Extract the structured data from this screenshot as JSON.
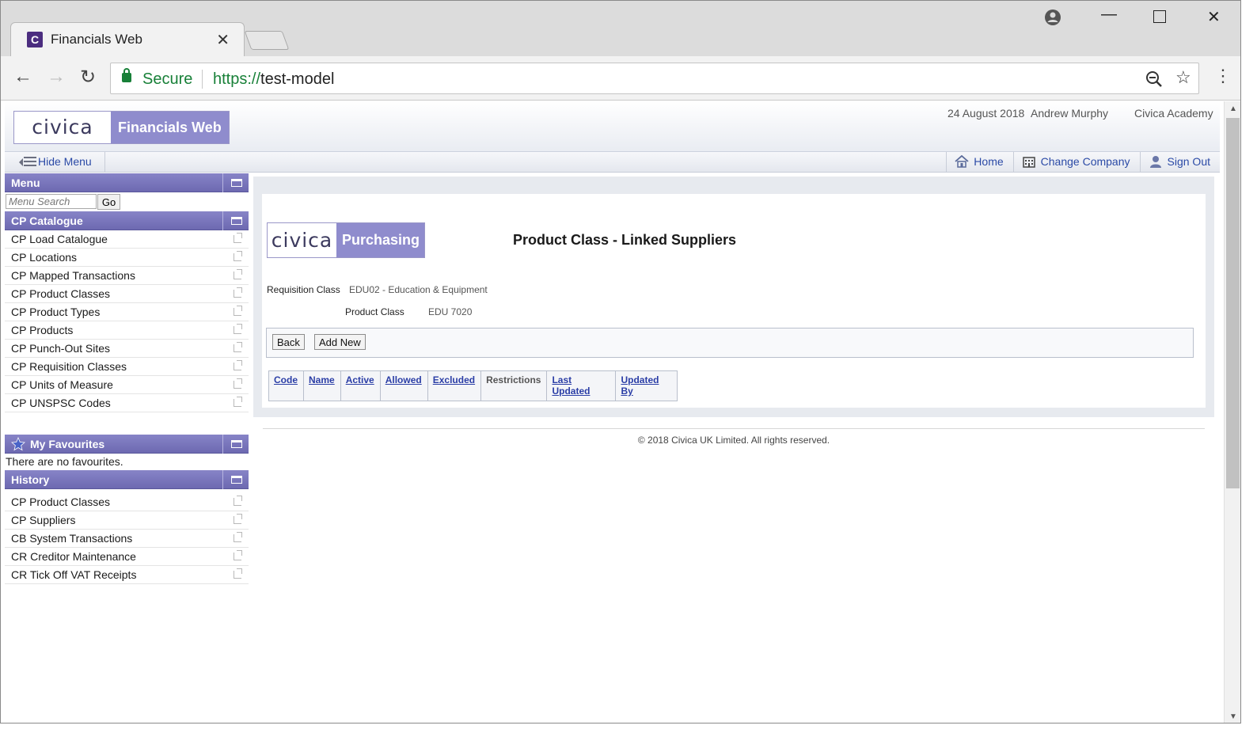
{
  "browser": {
    "tab_title": "Financials Web",
    "tab_favicon_letter": "C",
    "security_label": "Secure",
    "url_scheme": "https://",
    "url_host": "test-model"
  },
  "header": {
    "logo_brand": "civica",
    "logo_product": "Financials Web",
    "date": "24 August 2018",
    "user": "Andrew Murphy",
    "company": "Civica Academy"
  },
  "subbar": {
    "hide_menu": "Hide Menu",
    "home": "Home",
    "change_company": "Change Company",
    "sign_out": "Sign Out"
  },
  "sidebar": {
    "menu_title": "Menu",
    "search_placeholder": "Menu Search",
    "go_label": "Go",
    "catalogue_title": "CP Catalogue",
    "catalogue_items": [
      {
        "label": "CP Load Catalogue"
      },
      {
        "label": "CP Locations"
      },
      {
        "label": "CP Mapped Transactions"
      },
      {
        "label": "CP Product Classes"
      },
      {
        "label": "CP Product Types"
      },
      {
        "label": "CP Products"
      },
      {
        "label": "CP Punch-Out Sites"
      },
      {
        "label": "CP Requisition Classes"
      },
      {
        "label": "CP Units of Measure"
      },
      {
        "label": "CP UNSPSC Codes"
      }
    ],
    "favourites_title": "My Favourites",
    "favourites_empty": "There are no favourites.",
    "history_title": "History",
    "history_items": [
      {
        "label": "CP Product Classes"
      },
      {
        "label": "CP Suppliers"
      },
      {
        "label": "CB System Transactions"
      },
      {
        "label": "CR Creditor Maintenance"
      },
      {
        "label": "CR Tick Off VAT Receipts"
      }
    ]
  },
  "main": {
    "logo_brand": "civica",
    "logo_product": "Purchasing",
    "title": "Product Class - Linked Suppliers",
    "requisition_class_label": "Requisition Class",
    "requisition_class_value": "EDU02 - Education & Equipment",
    "product_class_label": "Product Class",
    "product_class_value": "EDU 7020",
    "back_label": "Back",
    "add_new_label": "Add New",
    "columns": {
      "code": "Code",
      "name": "Name",
      "active": "Active",
      "allowed": "Allowed",
      "excluded": "Excluded",
      "restrictions": "Restrictions",
      "last_updated_1": "Last",
      "last_updated_2": "Updated",
      "updated_by_1": "Updated",
      "updated_by_2": "By"
    }
  },
  "footer": {
    "copyright": "© 2018 Civica UK Limited. All rights reserved."
  },
  "colors": {
    "brand_purple": "#8f8ccd",
    "panel_header": "#6d69b1",
    "link_blue": "#2b4aa6",
    "secure_green": "#188038"
  }
}
